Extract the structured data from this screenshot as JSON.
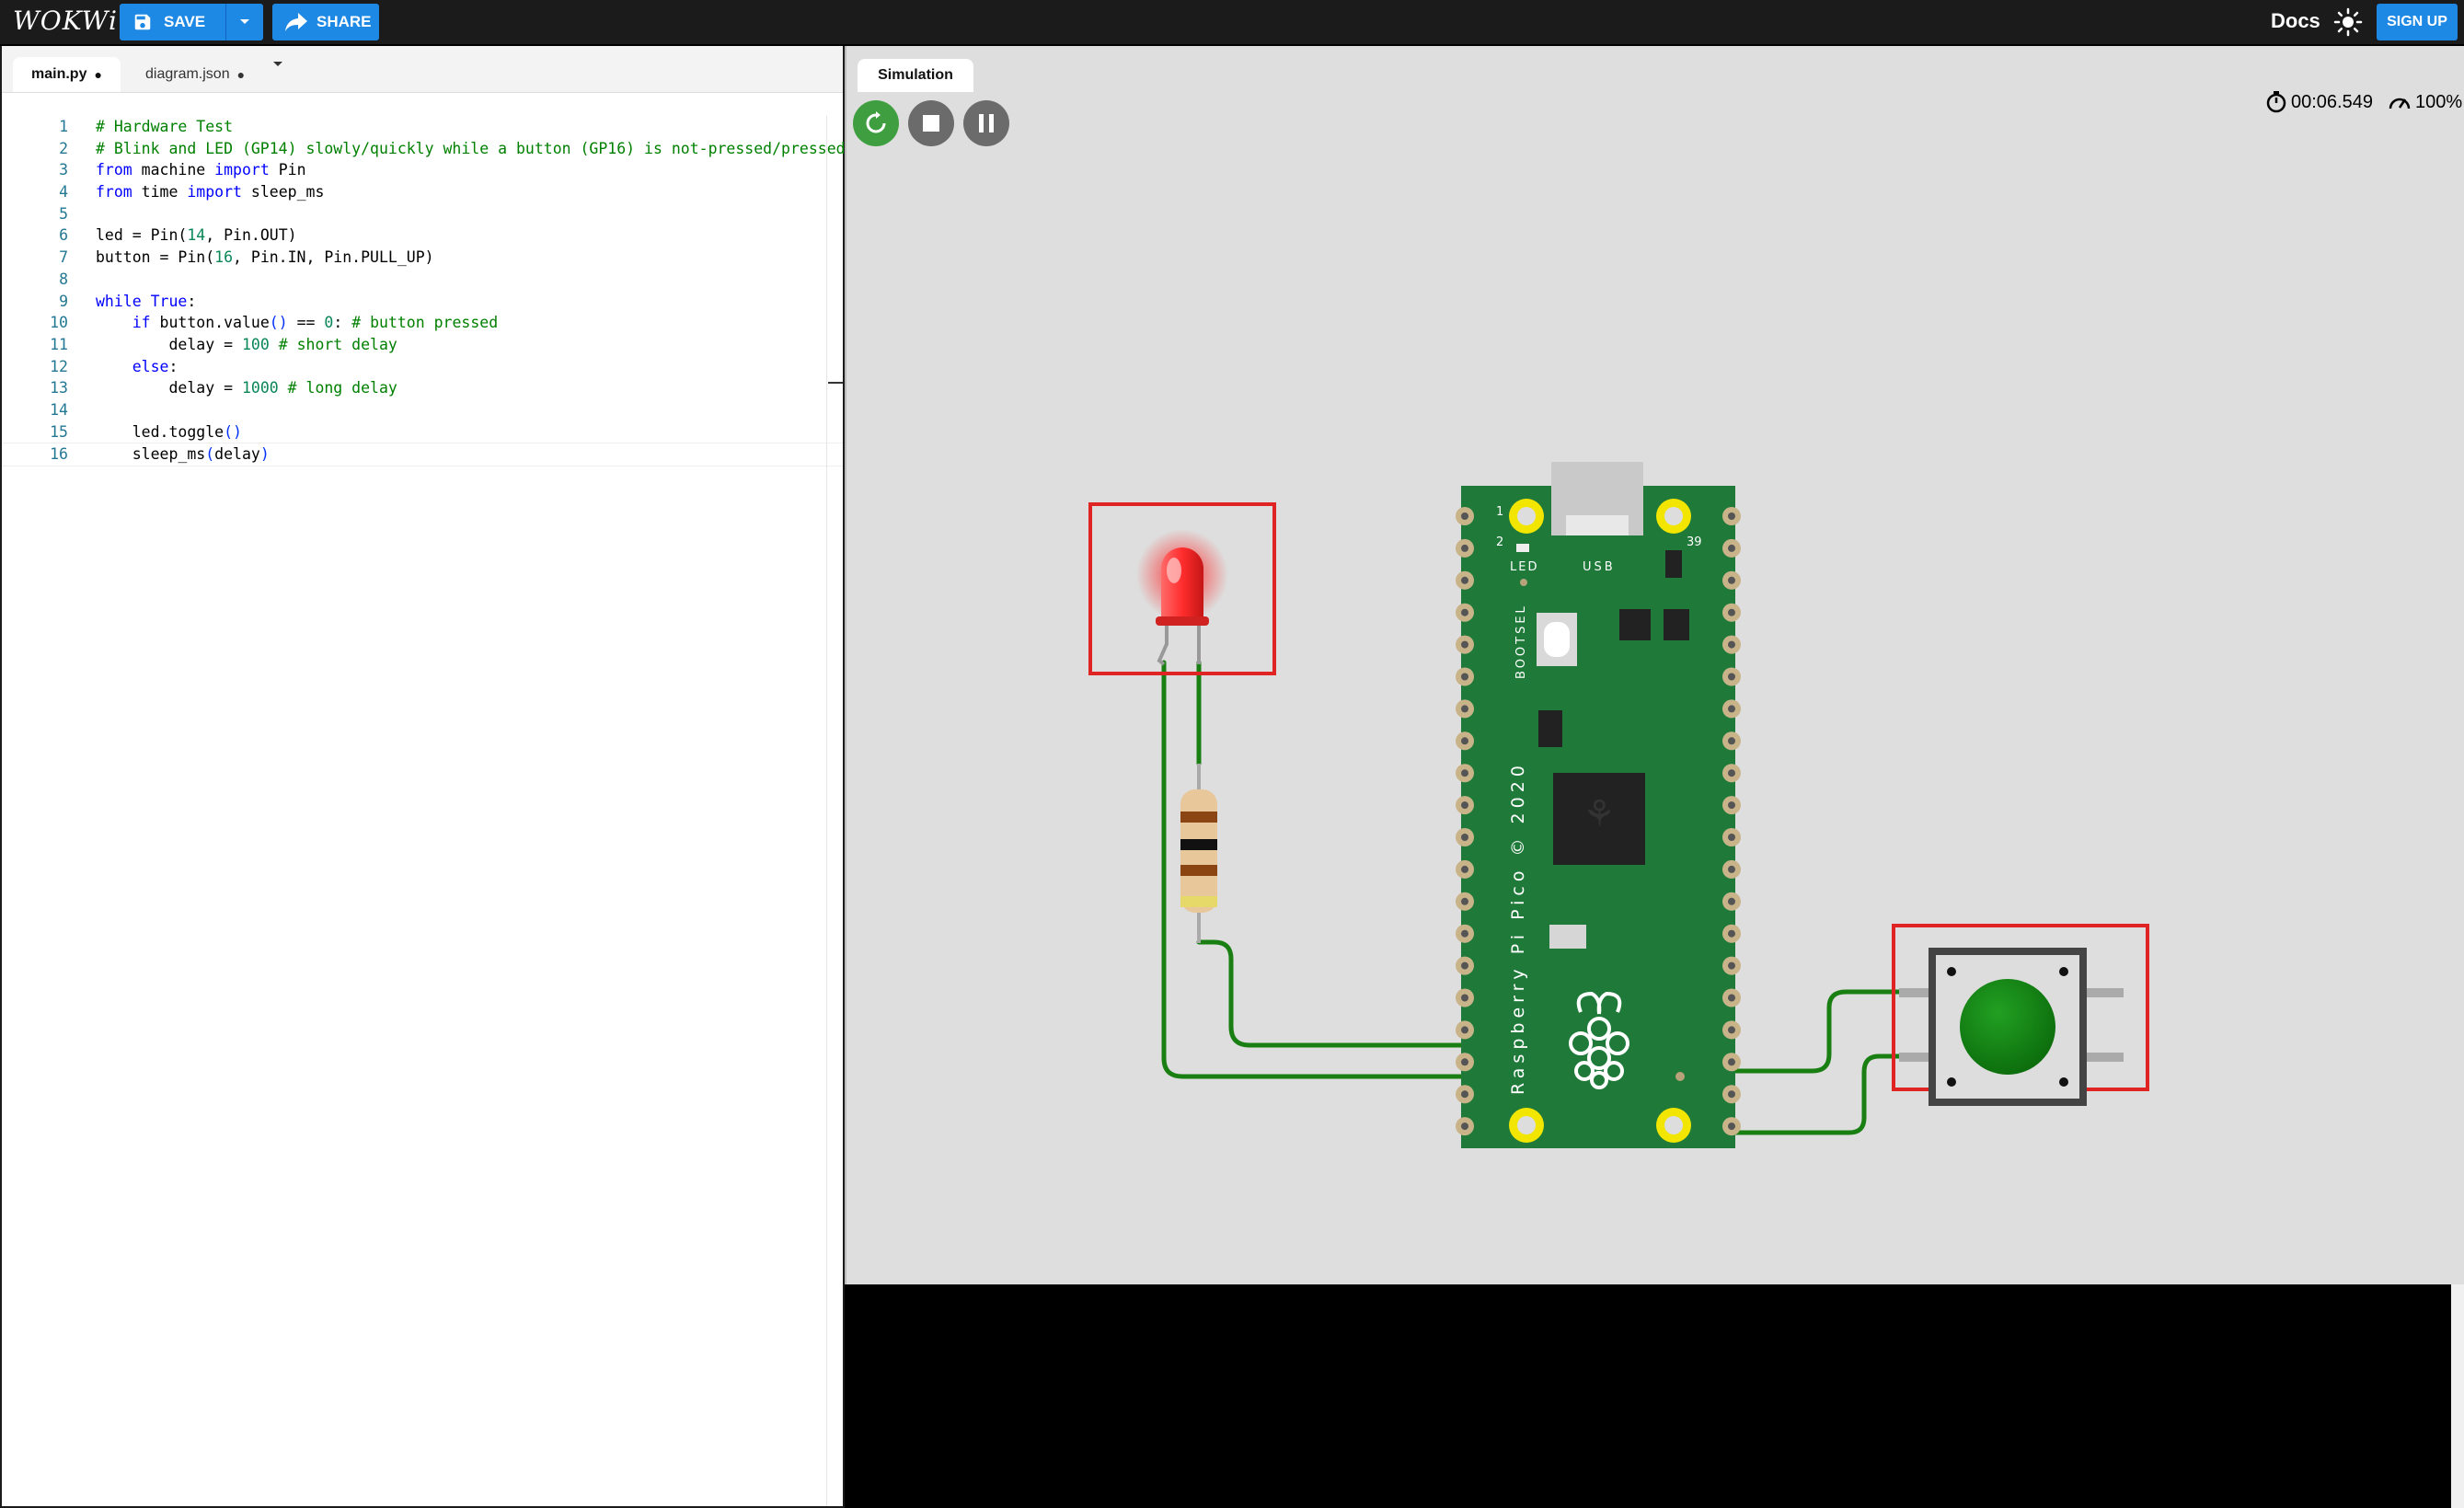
{
  "app": {
    "logo": "WOKWi",
    "save_label": "SAVE",
    "share_label": "SHARE",
    "docs_label": "Docs",
    "signup_label": "SIGN UP",
    "accent_color": "#1e88e5"
  },
  "editor": {
    "tabs": [
      {
        "label": "main.py",
        "modified": "●"
      },
      {
        "label": "diagram.json",
        "modified": "●"
      }
    ],
    "lines": [
      {
        "n": "1",
        "html": "<span class='c'># Hardware Test</span>"
      },
      {
        "n": "2",
        "html": "<span class='c'># Blink and LED (GP14) slowly/quickly while a button (GP16) is not-pressed/pressed</span>"
      },
      {
        "n": "3",
        "html": "<span class='k'>from</span> machine <span class='k'>import</span> Pin"
      },
      {
        "n": "4",
        "html": "<span class='k'>from</span> time <span class='k'>import</span> sleep_ms"
      },
      {
        "n": "5",
        "html": ""
      },
      {
        "n": "6",
        "html": "led = Pin(<span class='n'>14</span>, Pin.OUT)"
      },
      {
        "n": "7",
        "html": "button = Pin(<span class='n'>16</span>, Pin.IN, Pin.PULL_UP)"
      },
      {
        "n": "8",
        "html": ""
      },
      {
        "n": "9",
        "html": "<span class='k'>while</span> <span class='k'>True</span>:"
      },
      {
        "n": "10",
        "html": "    <span class='k'>if</span> button.value<span class='p'>()</span> == <span class='n'>0</span>: <span class='c'># button pressed</span>"
      },
      {
        "n": "11",
        "html": "        delay = <span class='n'>100</span> <span class='c'># short delay</span>"
      },
      {
        "n": "12",
        "html": "    <span class='k'>else</span>:"
      },
      {
        "n": "13",
        "html": "        delay = <span class='n'>1000</span> <span class='c'># long delay</span>"
      },
      {
        "n": "14",
        "html": ""
      },
      {
        "n": "15",
        "html": "    led.toggle<span class='p'>()</span>"
      },
      {
        "n": "16",
        "html": "    sleep_ms<span class='p'>(</span>delay<span class='p'>)</span>"
      }
    ]
  },
  "simulation": {
    "tab_label": "Simulation",
    "elapsed": "00:06.549",
    "speed": "100%",
    "board": {
      "led_label": "LED",
      "usb_label": "USB",
      "bootsel_label": "BOOTSEL",
      "name_label": "Raspberry Pi Pico © 2020",
      "pin1": "1",
      "pin2": "2",
      "pin39": "39"
    },
    "colors": {
      "wire": "#1a7f12",
      "board": "#1f7a3a",
      "highlight": "#e02424",
      "led": "#ff3b3b",
      "button": "#118a11"
    }
  }
}
